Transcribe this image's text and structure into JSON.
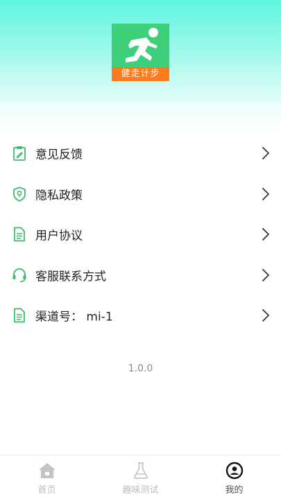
{
  "logo": {
    "caption": "健走计步"
  },
  "menu": {
    "items": [
      {
        "label": "意见反馈",
        "icon": "feedback-clipboard-icon"
      },
      {
        "label": "隐私政策",
        "icon": "privacy-shield-icon"
      },
      {
        "label": "用户协议",
        "icon": "document-icon"
      },
      {
        "label": "客服联系方式",
        "icon": "headset-icon"
      },
      {
        "label": "渠道号： mi-1",
        "icon": "document-icon"
      }
    ]
  },
  "version": "1.0.0",
  "tabbar": {
    "tabs": [
      {
        "label": "首页",
        "icon": "home-icon",
        "active": false
      },
      {
        "label": "趣味测试",
        "icon": "flask-icon",
        "active": false
      },
      {
        "label": "我的",
        "icon": "user-circle-icon",
        "active": true
      }
    ]
  },
  "colors": {
    "accent": "#3dbb6a",
    "logo_bg": "#3dcf7a",
    "logo_band": "#ff7a1a",
    "header_gradient_top": "#5ef5dc"
  }
}
